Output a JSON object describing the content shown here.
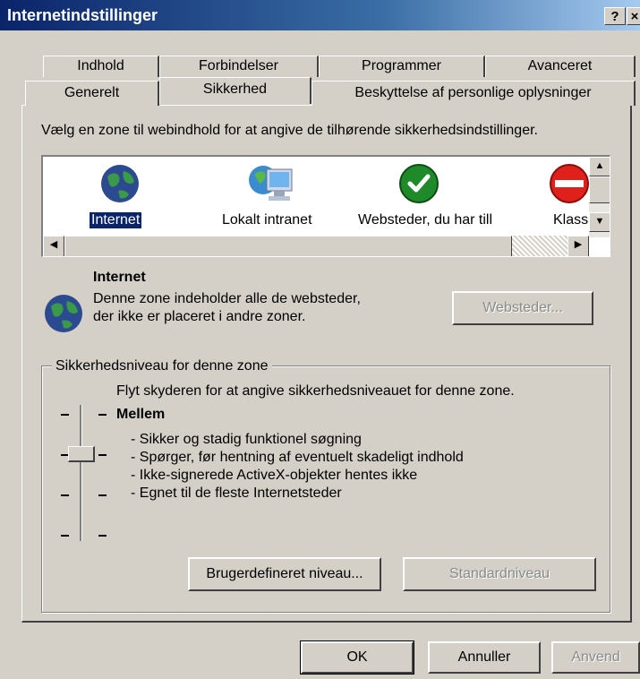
{
  "window": {
    "title": "Internetindstillinger",
    "help_label": "?",
    "close_label": "×"
  },
  "tabs_row1": [
    {
      "label": "Indhold"
    },
    {
      "label": "Forbindelser"
    },
    {
      "label": "Programmer"
    },
    {
      "label": "Avanceret"
    }
  ],
  "tabs_row2": [
    {
      "label": "Generelt"
    },
    {
      "label": "Sikkerhed"
    },
    {
      "label": "Beskyttelse af personlige oplysninger"
    }
  ],
  "instructions": "Vælg en zone til webindhold for at angive de tilhørende sikkerhedsindstillinger.",
  "zones": [
    {
      "label": "Internet",
      "icon": "globe-icon",
      "selected": true
    },
    {
      "label": "Lokalt intranet",
      "icon": "intranet-computer-icon",
      "selected": false
    },
    {
      "label": "Websteder, du har tillid til",
      "icon": "trusted-checkmark-icon",
      "selected": false
    },
    {
      "label": "Klassificerede websteder",
      "icon": "restricted-no-entry-icon",
      "selected": false
    }
  ],
  "zone_info": {
    "name": "Internet",
    "desc1": "Denne zone indeholder alle de websteder,",
    "desc2": "der ikke er placeret i andre zoner.",
    "sites_button": "Websteder..."
  },
  "security": {
    "group_label": "Sikkerhedsniveau for denne zone",
    "instruction": "Flyt skyderen for at angive sikkerhedsniveauet for denne zone.",
    "level_name": "Mellem",
    "bullets": [
      "- Sikker og stadig funktionel søgning",
      "- Spørger, før hentning af eventuelt skadeligt indhold",
      "- Ikke-signerede ActiveX-objekter hentes ikke",
      "- Egnet til de fleste Internetsteder"
    ],
    "slider_level": "2 of 4",
    "custom_button": "Brugerdefineret niveau...",
    "default_button": "Standardniveau"
  },
  "footer": {
    "ok": "OK",
    "cancel": "Annuller",
    "apply": "Anvend"
  }
}
